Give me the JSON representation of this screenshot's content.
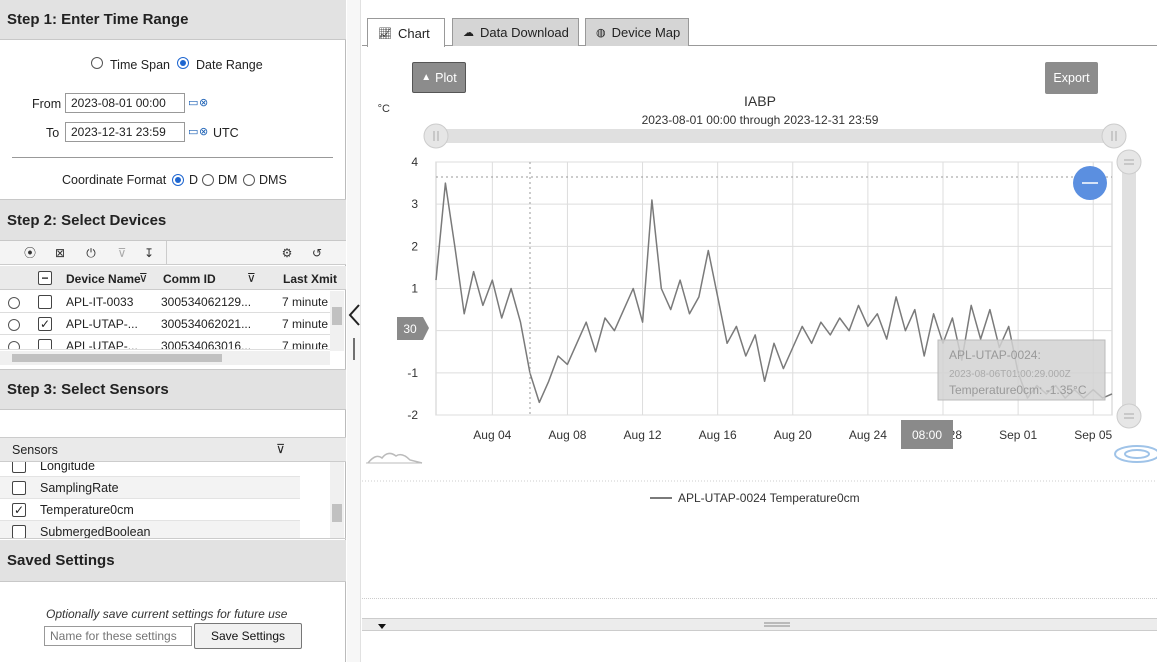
{
  "step1": {
    "title": "Step 1: Enter Time Range",
    "time_span_label": "Time Span",
    "date_range_label": "Date Range",
    "from_label": "From",
    "from_value": "2023-08-01 00:00",
    "to_label": "To",
    "to_value": "2023-12-31 23:59",
    "utc_label": "UTC",
    "coord_format_label": "Coordinate Format",
    "coord_options": [
      "D",
      "DM",
      "DMS"
    ]
  },
  "step2": {
    "title": "Step 2: Select Devices",
    "columns": [
      "Device Name",
      "Comm ID",
      "Last Xmit"
    ],
    "rows": [
      {
        "name": "APL-IT-0033",
        "comm_id": "300534062129...",
        "last": "7 minute",
        "checked": false
      },
      {
        "name": "APL-UTAP-...",
        "comm_id": "300534062021...",
        "last": "7 minute",
        "checked": true
      },
      {
        "name": "APL-UTAP-...",
        "comm_id": "300534063016...",
        "last": "7 minute",
        "checked": false
      }
    ]
  },
  "step3": {
    "title": "Step 3: Select Sensors",
    "column": "Sensors",
    "items": [
      {
        "label": "Longitude",
        "checked": false
      },
      {
        "label": "SamplingRate",
        "checked": false
      },
      {
        "label": "Temperature0cm",
        "checked": true
      },
      {
        "label": "SubmergedBoolean",
        "checked": false
      }
    ]
  },
  "saved": {
    "title": "Saved Settings",
    "hint": "Optionally save current settings for future use",
    "name_placeholder": "Name for these settings",
    "save_label": "Save Settings"
  },
  "tabs": [
    "Chart",
    "Data Download",
    "Device Map"
  ],
  "plot_label": "Plot",
  "export_label": "Export",
  "chart_data": {
    "type": "line",
    "title": "IABP",
    "subtitle": "2023-08-01 00:00 through 2023-12-31 23:59",
    "ylabel": "°C",
    "ylim": [
      -2,
      4
    ],
    "yticks": [
      4,
      3,
      2,
      1,
      0,
      -1,
      -2
    ],
    "xlim": [
      "2023-08-01",
      "2023-09-06"
    ],
    "xticks": [
      "Aug 04",
      "Aug 08",
      "Aug 12",
      "Aug 16",
      "Aug 20",
      "Aug 24",
      "Aug 28",
      "Sep 01",
      "Sep 05"
    ],
    "hover_x_label": "08:00",
    "hover_y_label": "30",
    "series": [
      {
        "name": "APL-UTAP-0024 Temperature0cm",
        "color": "#7a7a7a",
        "points": [
          [
            "2023-08-01",
            1.2
          ],
          [
            "2023-08-01 12:00",
            3.5
          ],
          [
            "2023-08-02",
            2.0
          ],
          [
            "2023-08-02 12:00",
            0.4
          ],
          [
            "2023-08-03",
            1.4
          ],
          [
            "2023-08-03 12:00",
            0.6
          ],
          [
            "2023-08-04",
            1.2
          ],
          [
            "2023-08-04 12:00",
            0.3
          ],
          [
            "2023-08-05",
            1.0
          ],
          [
            "2023-08-05 12:00",
            0.2
          ],
          [
            "2023-08-06",
            -1.0
          ],
          [
            "2023-08-06 12:00",
            -1.7
          ],
          [
            "2023-08-07",
            -1.2
          ],
          [
            "2023-08-07 12:00",
            -0.6
          ],
          [
            "2023-08-08",
            -0.8
          ],
          [
            "2023-08-08 12:00",
            -0.3
          ],
          [
            "2023-08-09",
            0.2
          ],
          [
            "2023-08-09 12:00",
            -0.5
          ],
          [
            "2023-08-10",
            0.3
          ],
          [
            "2023-08-10 12:00",
            0.0
          ],
          [
            "2023-08-11",
            0.5
          ],
          [
            "2023-08-11 12:00",
            1.0
          ],
          [
            "2023-08-12",
            0.2
          ],
          [
            "2023-08-12 12:00",
            3.1
          ],
          [
            "2023-08-13",
            1.0
          ],
          [
            "2023-08-13 12:00",
            0.5
          ],
          [
            "2023-08-14",
            1.2
          ],
          [
            "2023-08-14 12:00",
            0.4
          ],
          [
            "2023-08-15",
            0.8
          ],
          [
            "2023-08-15 12:00",
            1.9
          ],
          [
            "2023-08-16",
            0.8
          ],
          [
            "2023-08-16 12:00",
            -0.3
          ],
          [
            "2023-08-17",
            0.1
          ],
          [
            "2023-08-17 12:00",
            -0.6
          ],
          [
            "2023-08-18",
            -0.1
          ],
          [
            "2023-08-18 12:00",
            -1.2
          ],
          [
            "2023-08-19",
            -0.3
          ],
          [
            "2023-08-19 12:00",
            -0.9
          ],
          [
            "2023-08-20",
            -0.4
          ],
          [
            "2023-08-20 12:00",
            0.1
          ],
          [
            "2023-08-21",
            -0.3
          ],
          [
            "2023-08-21 12:00",
            0.2
          ],
          [
            "2023-08-22",
            -0.1
          ],
          [
            "2023-08-22 12:00",
            0.3
          ],
          [
            "2023-08-23",
            0.0
          ],
          [
            "2023-08-23 12:00",
            0.6
          ],
          [
            "2023-08-24",
            0.1
          ],
          [
            "2023-08-24 12:00",
            0.4
          ],
          [
            "2023-08-25",
            -0.2
          ],
          [
            "2023-08-25 12:00",
            0.8
          ],
          [
            "2023-08-26",
            0.0
          ],
          [
            "2023-08-26 12:00",
            0.5
          ],
          [
            "2023-08-27",
            -0.6
          ],
          [
            "2023-08-27 12:00",
            0.4
          ],
          [
            "2023-08-28",
            -0.3
          ],
          [
            "2023-08-28 12:00",
            0.3
          ],
          [
            "2023-08-29",
            -0.7
          ],
          [
            "2023-08-29 12:00",
            0.6
          ],
          [
            "2023-08-30",
            -0.2
          ],
          [
            "2023-08-30 12:00",
            0.5
          ],
          [
            "2023-08-31",
            -0.4
          ],
          [
            "2023-08-31 12:00",
            0.1
          ],
          [
            "2023-09-01",
            -1.0
          ],
          [
            "2023-09-01 12:00",
            -1.6
          ],
          [
            "2023-09-02",
            -1.3
          ],
          [
            "2023-09-02 12:00",
            -1.5
          ],
          [
            "2023-09-03",
            -1.3
          ],
          [
            "2023-09-03 12:00",
            -1.6
          ],
          [
            "2023-09-04",
            -1.4
          ],
          [
            "2023-09-04 12:00",
            -1.6
          ],
          [
            "2023-09-05",
            -1.4
          ],
          [
            "2023-09-05 12:00",
            -1.6
          ],
          [
            "2023-09-06",
            -1.5
          ]
        ]
      }
    ],
    "tooltip": {
      "device": "APL-UTAP-0024:",
      "time": "2023-08-06T01:00:29.000Z",
      "value": "Temperature0cm: -1.35°C"
    }
  }
}
